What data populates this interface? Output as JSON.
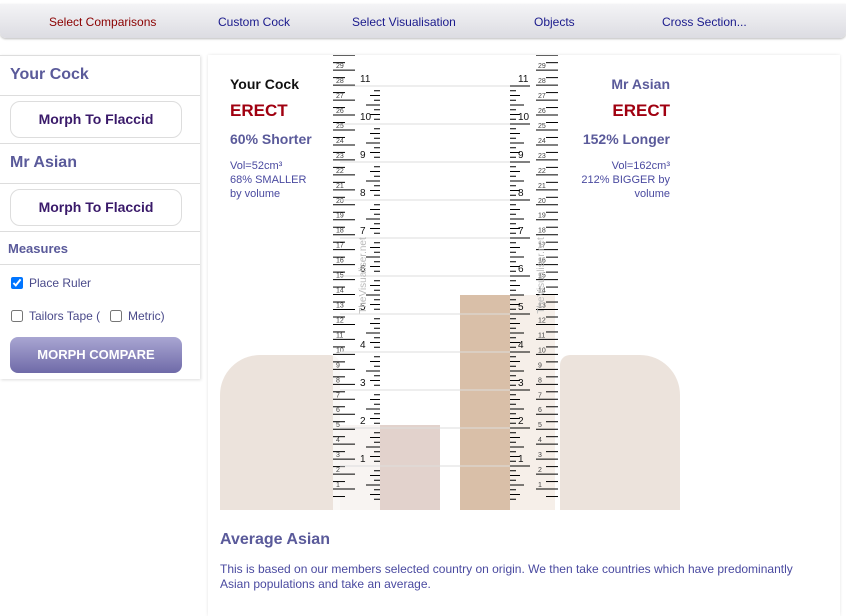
{
  "nav": {
    "items": [
      "Select Comparisons",
      "Custom Cock",
      "Select Visualisation",
      "Objects",
      "Cross Section..."
    ],
    "active": 0
  },
  "sidebar": {
    "your_title": "Your Cock",
    "morph1": "Morph To Flaccid",
    "other_title": "Mr Asian",
    "morph2": "Morph To Flaccid",
    "measures": "Measures",
    "place_ruler": "Place Ruler",
    "place_ruler_checked": true,
    "tailors_tape": "Tailors Tape (",
    "tailors_checked": false,
    "metric": "Metric)",
    "metric_checked": false,
    "morph_compare": "MORPH COMPARE"
  },
  "left": {
    "title": "Your Cock",
    "state": "ERECT",
    "diff": "60% Shorter",
    "vol": "Vol=52cm³",
    "vol_diff": "68% SMALLER",
    "by": "by volume"
  },
  "right": {
    "title": "Mr Asian",
    "state": "ERECT",
    "diff": "152% Longer",
    "vol": "Vol=162cm³",
    "vol_diff": "212% BIGGER by",
    "by": "volume"
  },
  "ruler": {
    "inches": [
      1,
      2,
      3,
      4,
      5,
      6,
      7,
      8,
      9,
      10,
      11
    ],
    "cm_max": 30,
    "watermark": "TheVisualiser.net"
  },
  "footer": {
    "title": "Average Asian",
    "text": "This is based on our members selected country on origin. We then take countries which have predominantly Asian populations and take an average."
  },
  "colors": {
    "accent": "#5a5a9a",
    "erect": "#a00010",
    "nav_active": "#8b0000",
    "nav": "#1a1a8c"
  }
}
